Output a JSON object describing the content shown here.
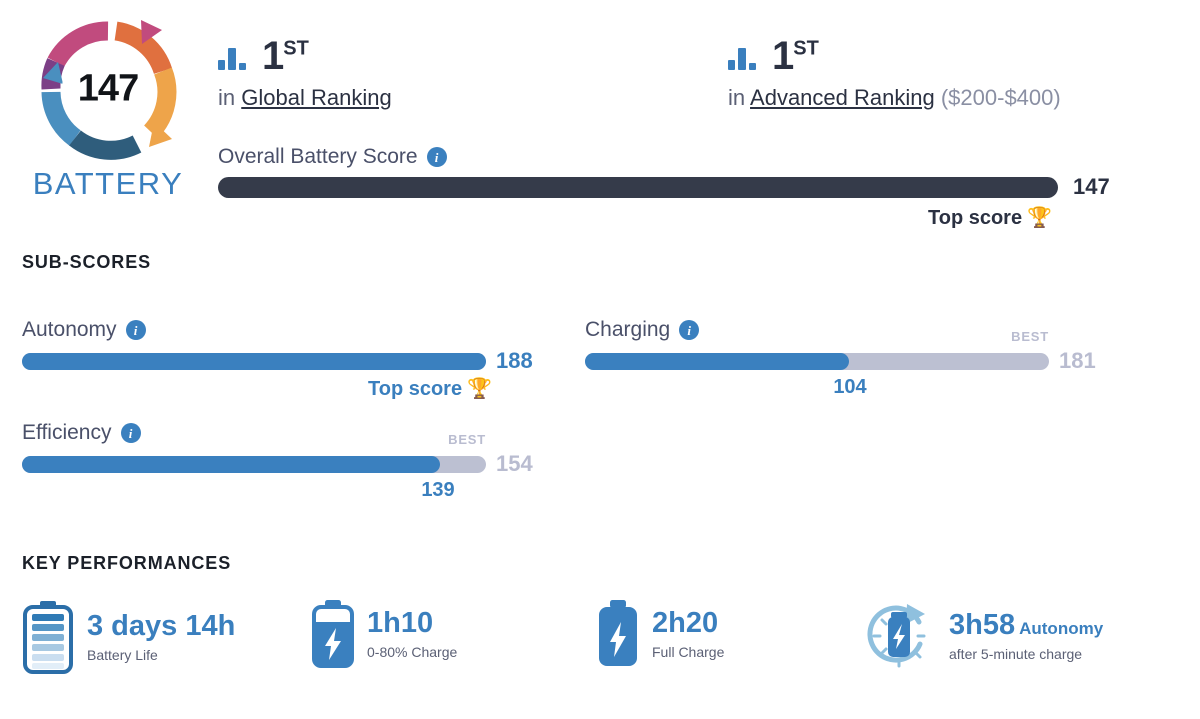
{
  "logo": {
    "score": "147",
    "word": "BATTERY",
    "ring_colors": [
      "#c14b7e",
      "#7c3f86",
      "#e0703f",
      "#eea44a",
      "#4a8fbf",
      "#2f5d7c"
    ]
  },
  "rankings": [
    {
      "icon": "bar-chart-icon",
      "position": "1",
      "suffix": "ST",
      "prefix": "in",
      "link": "Global Ranking",
      "extra": ""
    },
    {
      "icon": "bar-chart-icon",
      "position": "1",
      "suffix": "ST",
      "prefix": "in",
      "link": "Advanced Ranking",
      "extra": "($200-$400)"
    }
  ],
  "overall": {
    "label": "Overall Battery Score",
    "info_icon": "info-icon",
    "value": "147",
    "top_score_text": "Top score",
    "trophy_icon": "trophy-icon",
    "bar_color": "#353b4a",
    "fill_percent": 100
  },
  "sections": {
    "subscores_title": "SUB-SCORES",
    "key_performances_title": "KEY PERFORMANCES"
  },
  "subscores": [
    {
      "name": "Autonomy",
      "info_icon": "info-icon",
      "value": "188",
      "best_label": "",
      "best_value": "",
      "fill_percent": 100,
      "is_top": true,
      "top_score_text": "Top score",
      "trophy_icon": "trophy-icon"
    },
    {
      "name": "Charging",
      "info_icon": "info-icon",
      "value": "104",
      "best_label": "BEST",
      "best_value": "181",
      "fill_percent": 57,
      "is_top": false,
      "top_score_text": "",
      "trophy_icon": ""
    },
    {
      "name": "Efficiency",
      "info_icon": "info-icon",
      "value": "139",
      "best_label": "BEST",
      "best_value": "154",
      "fill_percent": 90,
      "is_top": false,
      "top_score_text": "",
      "trophy_icon": ""
    }
  ],
  "key_performances": [
    {
      "icon": "battery-levels-icon",
      "value": "3 days 14h",
      "value_suffix": "",
      "label": "Battery Life"
    },
    {
      "icon": "battery-charging-partial-icon",
      "value": "1h10",
      "value_suffix": "",
      "label": "0-80% Charge"
    },
    {
      "icon": "battery-charging-full-icon",
      "value": "2h20",
      "value_suffix": "",
      "label": "Full Charge"
    },
    {
      "icon": "quick-charge-icon",
      "value": "3h58",
      "value_suffix": "Autonomy",
      "label": "after 5-minute charge"
    }
  ],
  "colors": {
    "blue": "#3a80bf",
    "dark": "#353b4a",
    "track": "#bcc0d2",
    "muted": "#b9bcd0",
    "gold": "#f2bb44"
  }
}
